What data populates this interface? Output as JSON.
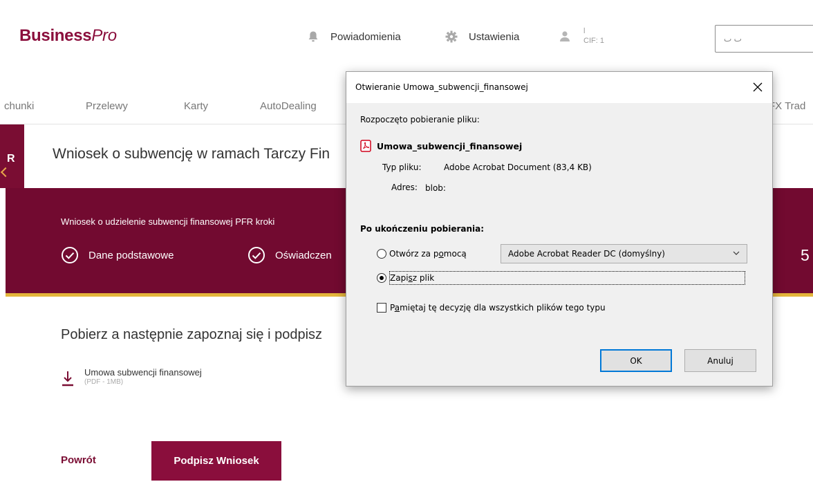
{
  "header": {
    "logo_bold": "Business",
    "logo_italic": "Pro",
    "notifications": "Powiadomienia",
    "settings": "Ustawienia",
    "user_line1": "l",
    "user_line2": "CIF: 1",
    "select_value": "ٮ‌ ٮ"
  },
  "nav": {
    "items": [
      "chunki",
      "Przelewy",
      "Karty",
      "AutoDealing",
      "FX Trad"
    ]
  },
  "side_tab": {
    "label": "R"
  },
  "page": {
    "title": "Wniosek o subwencję w ramach Tarczy Fin"
  },
  "steps": {
    "title": "Wniosek o udzielenie subwencji finansowej PFR kroki",
    "items": [
      "Dane podstawowe",
      "Oświadczen"
    ],
    "number": "5"
  },
  "content": {
    "title": "Pobierz a następnie zapoznaj się i podpisz",
    "download_name": "Umowa subwencji finansowej",
    "download_meta": "(PDF - 1MB)",
    "back": "Powrót",
    "sign": "Podpisz Wniosek"
  },
  "dialog": {
    "title": "Otwieranie Umowa_subwencji_finansowej",
    "started": "Rozpoczęto pobieranie pliku:",
    "file_name": "Umowa_subwencji_finansowej",
    "type_label": "Typ pliku:",
    "type_value": "Adobe Acrobat Document (83,4 KB)",
    "address_label": "Adres:",
    "address_value": "blob:",
    "after_label": "Po ukończeniu pobierania:",
    "open_with_pre": "Otwórz za p",
    "open_with_u": "o",
    "open_with_post": "mocą",
    "app_value": "Adobe Acrobat Reader DC  (domyślny)",
    "save_pre": "Zapi",
    "save_u": "s",
    "save_post": "z plik",
    "remember_pre": "P",
    "remember_u": "a",
    "remember_post": "miętaj tę decyzję dla wszystkich plików tego typu",
    "ok": "OK",
    "cancel": "Anuluj",
    "selected": "save"
  },
  "colors": {
    "brand": "#8a0e3c",
    "band": "#720a30",
    "accent": "#e3b53b",
    "focus": "#0078d7"
  }
}
